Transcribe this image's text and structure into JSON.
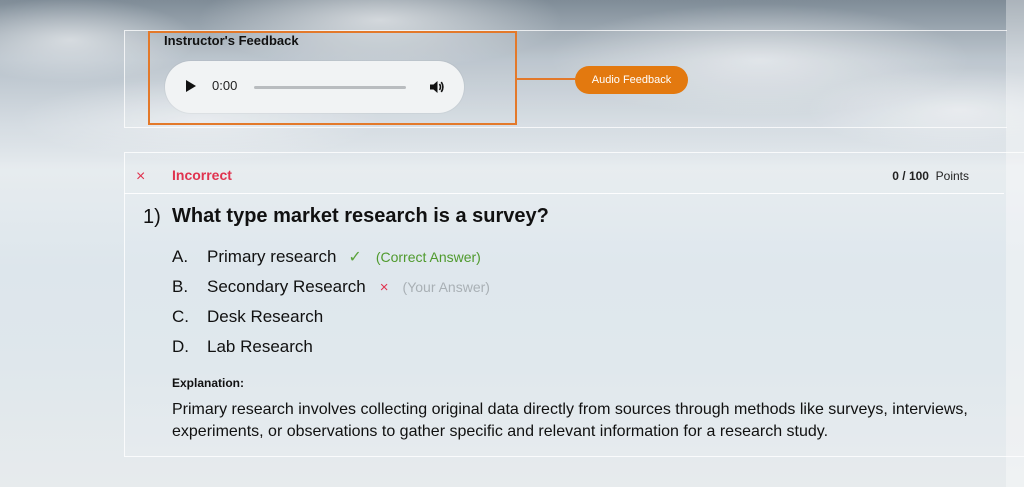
{
  "feedback": {
    "title": "Instructor's Feedback",
    "audio_time": "0:00",
    "badge_label": "Audio Feedback"
  },
  "question": {
    "status_icon": "×",
    "status": "Incorrect",
    "score_value": "0 / 100",
    "score_unit": "Points",
    "number": "1)",
    "text": "What type market research is a survey?",
    "options": [
      {
        "letter": "A.",
        "text": "Primary research",
        "mark": "✓",
        "note": "(Correct Answer)"
      },
      {
        "letter": "B.",
        "text": "Secondary Research",
        "mark": "×",
        "note": "(Your Answer)"
      },
      {
        "letter": "C.",
        "text": "Desk Research"
      },
      {
        "letter": "D.",
        "text": "Lab Research"
      }
    ],
    "explanation_label": "Explanation:",
    "explanation": "Primary research involves collecting original data directly from sources through methods like surveys, interviews, experiments, or observations to gather specific and relevant information for a research study."
  },
  "colors": {
    "accent": "#e3790f",
    "incorrect": "#e0334f",
    "correct": "#4f9a2d"
  },
  "icons": {
    "play": "play-icon",
    "volume": "volume-icon",
    "incorrect": "close-icon",
    "correct": "checkmark-icon"
  }
}
